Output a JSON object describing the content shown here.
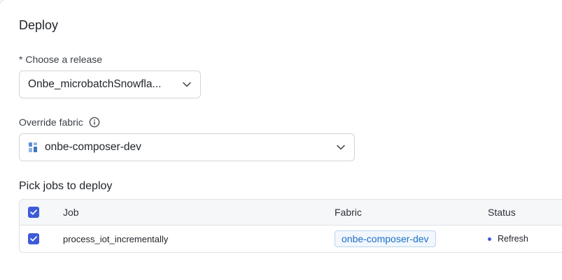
{
  "dialog": {
    "title": "Deploy"
  },
  "release": {
    "label": "* Choose a release",
    "value": "Onbe_microbatchSnowfla..."
  },
  "fabric": {
    "label": "Override fabric",
    "value": "onbe-composer-dev"
  },
  "jobs": {
    "section_title": "Pick jobs to deploy",
    "columns": {
      "job": "Job",
      "fabric": "Fabric",
      "status": "Status"
    },
    "header_checked": true,
    "rows": [
      {
        "checked": true,
        "job": "process_iot_incrementally",
        "fabric": "onbe-composer-dev",
        "status": "Refresh"
      }
    ]
  },
  "colors": {
    "accent": "#3d5bd9",
    "tag_text": "#1f6fc5",
    "tag_border": "#b9d4ef"
  },
  "icons": {
    "info": "info-icon",
    "chevron": "chevron-down-icon",
    "fabric": "fabric-icon",
    "check": "checkbox-checked-icon"
  }
}
